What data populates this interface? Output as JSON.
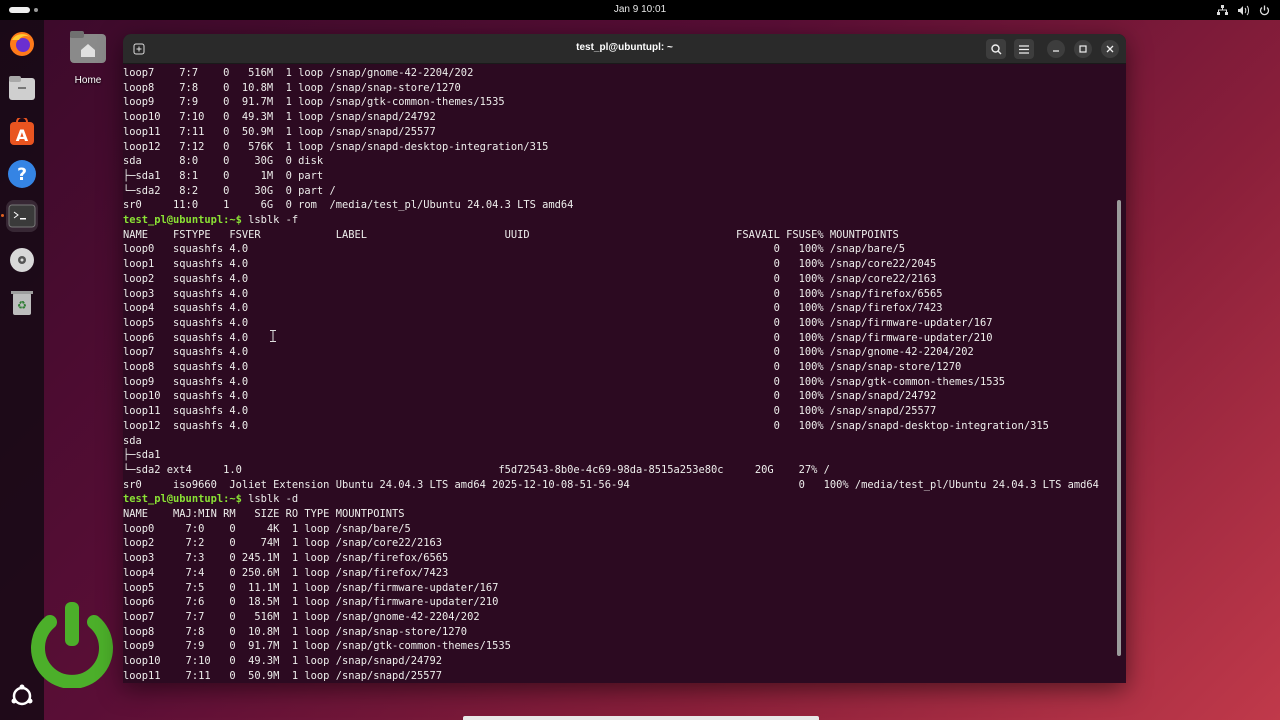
{
  "topbar": {
    "clock": "Jan 9  10:01"
  },
  "desktop": {
    "home_label": "Home"
  },
  "window": {
    "title": "test_pl@ubuntupl: ~"
  },
  "terminal": {
    "prompt": "test_pl@ubuntupl:~$",
    "lines": [
      {
        "t": "loop7    7:7    0   516M  1 loop /snap/gnome-42-2204/202"
      },
      {
        "t": "loop8    7:8    0  10.8M  1 loop /snap/snap-store/1270"
      },
      {
        "t": "loop9    7:9    0  91.7M  1 loop /snap/gtk-common-themes/1535"
      },
      {
        "t": "loop10   7:10   0  49.3M  1 loop /snap/snapd/24792"
      },
      {
        "t": "loop11   7:11   0  50.9M  1 loop /snap/snapd/25577"
      },
      {
        "t": "loop12   7:12   0   576K  1 loop /snap/snapd-desktop-integration/315"
      },
      {
        "t": "sda      8:0    0    30G  0 disk"
      },
      {
        "t": "├─sda1   8:1    0     1M  0 part"
      },
      {
        "t": "└─sda2   8:2    0    30G  0 part /"
      },
      {
        "t": "sr0     11:0    1     6G  0 rom  /media/test_pl/Ubuntu 24.04.3 LTS amd64"
      },
      {
        "p": true,
        "t": " lsblk -f"
      },
      {
        "t": "NAME    FSTYPE   FSVER            LABEL                      UUID                                 FSAVAIL FSUSE% MOUNTPOINTS"
      },
      {
        "t": "loop0   squashfs 4.0                                                                                    0   100% /snap/bare/5"
      },
      {
        "t": "loop1   squashfs 4.0                                                                                    0   100% /snap/core22/2045"
      },
      {
        "t": "loop2   squashfs 4.0                                                                                    0   100% /snap/core22/2163"
      },
      {
        "t": "loop3   squashfs 4.0                                                                                    0   100% /snap/firefox/6565"
      },
      {
        "t": "loop4   squashfs 4.0                                                                                    0   100% /snap/firefox/7423"
      },
      {
        "t": "loop5   squashfs 4.0                                                                                    0   100% /snap/firmware-updater/167"
      },
      {
        "t": "loop6   squashfs 4.0                                                                                    0   100% /snap/firmware-updater/210"
      },
      {
        "t": "loop7   squashfs 4.0                                                                                    0   100% /snap/gnome-42-2204/202"
      },
      {
        "t": "loop8   squashfs 4.0                                                                                    0   100% /snap/snap-store/1270"
      },
      {
        "t": "loop9   squashfs 4.0                                                                                    0   100% /snap/gtk-common-themes/1535"
      },
      {
        "t": "loop10  squashfs 4.0                                                                                    0   100% /snap/snapd/24792"
      },
      {
        "t": "loop11  squashfs 4.0                                                                                    0   100% /snap/snapd/25577"
      },
      {
        "t": "loop12  squashfs 4.0                                                                                    0   100% /snap/snapd-desktop-integration/315"
      },
      {
        "t": "sda"
      },
      {
        "t": "├─sda1"
      },
      {
        "t": "└─sda2 ext4     1.0                                         f5d72543-8b0e-4c69-98da-8515a253e80c     20G    27% /"
      },
      {
        "t": "sr0     iso9660  Joliet Extension Ubuntu 24.04.3 LTS amd64 2025-12-10-08-51-56-94                           0   100% /media/test_pl/Ubuntu 24.04.3 LTS amd64"
      },
      {
        "p": true,
        "t": " lsblk -d"
      },
      {
        "t": "NAME    MAJ:MIN RM   SIZE RO TYPE MOUNTPOINTS"
      },
      {
        "t": "loop0     7:0    0     4K  1 loop /snap/bare/5"
      },
      {
        "t": "loop2     7:2    0    74M  1 loop /snap/core22/2163"
      },
      {
        "t": "loop3     7:3    0 245.1M  1 loop /snap/firefox/6565"
      },
      {
        "t": "loop4     7:4    0 250.6M  1 loop /snap/firefox/7423"
      },
      {
        "t": "loop5     7:5    0  11.1M  1 loop /snap/firmware-updater/167"
      },
      {
        "t": "loop6     7:6    0  18.5M  1 loop /snap/firmware-updater/210"
      },
      {
        "t": "loop7     7:7    0   516M  1 loop /snap/gnome-42-2204/202"
      },
      {
        "t": "loop8     7:8    0  10.8M  1 loop /snap/snap-store/1270"
      },
      {
        "t": "loop9     7:9    0  91.7M  1 loop /snap/gtk-common-themes/1535"
      },
      {
        "t": "loop10    7:10   0  49.3M  1 loop /snap/snapd/24792"
      },
      {
        "t": "loop11    7:11   0  50.9M  1 loop /snap/snapd/25577"
      }
    ]
  },
  "dock": {
    "items": [
      "firefox-icon",
      "files-icon",
      "app-center-icon",
      "help-icon",
      "terminal-icon",
      "disc-icon",
      "trash-icon",
      "show-apps-icon"
    ]
  },
  "colors": {
    "prompt": "#8ae234",
    "terminal_bg": "#2c0a21",
    "text": "#eeeeec"
  }
}
